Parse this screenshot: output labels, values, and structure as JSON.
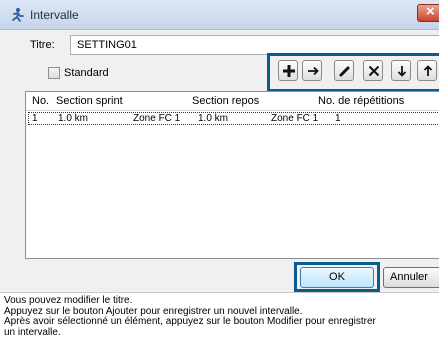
{
  "window": {
    "title": "Intervalle",
    "icon": "runner-icon"
  },
  "form": {
    "title_label": "Titre:",
    "title_value": "SETTING01",
    "standard_label": "Standard",
    "standard_checked": false
  },
  "toolbar": {
    "buttons": [
      "add-icon",
      "move-right-icon",
      "edit-pencil-icon",
      "delete-icon",
      "move-down-icon",
      "move-up-icon"
    ]
  },
  "list": {
    "headers": {
      "no": "No.",
      "sprint": "Section sprint",
      "repos": "Section repos",
      "reps": "No. de répétitions"
    },
    "rows": [
      {
        "no": "1",
        "sprint_dist": "1.0 km",
        "sprint_zone": "Zone FC 1",
        "repos_dist": "1.0 km",
        "repos_zone": "Zone FC 1",
        "reps": "1"
      }
    ]
  },
  "buttons": {
    "ok": "OK",
    "cancel": "Annuler"
  },
  "info": {
    "lines": [
      "Vous pouvez modifier le titre.",
      "Appuyez sur le bouton Ajouter pour enregistrer un nouvel intervalle.",
      "Après avoir sélectionné un élément, appuyez sur le bouton Modifier pour enregistrer",
      "un intervalle."
    ]
  },
  "colors": {
    "highlight": "#0a5c8f"
  }
}
